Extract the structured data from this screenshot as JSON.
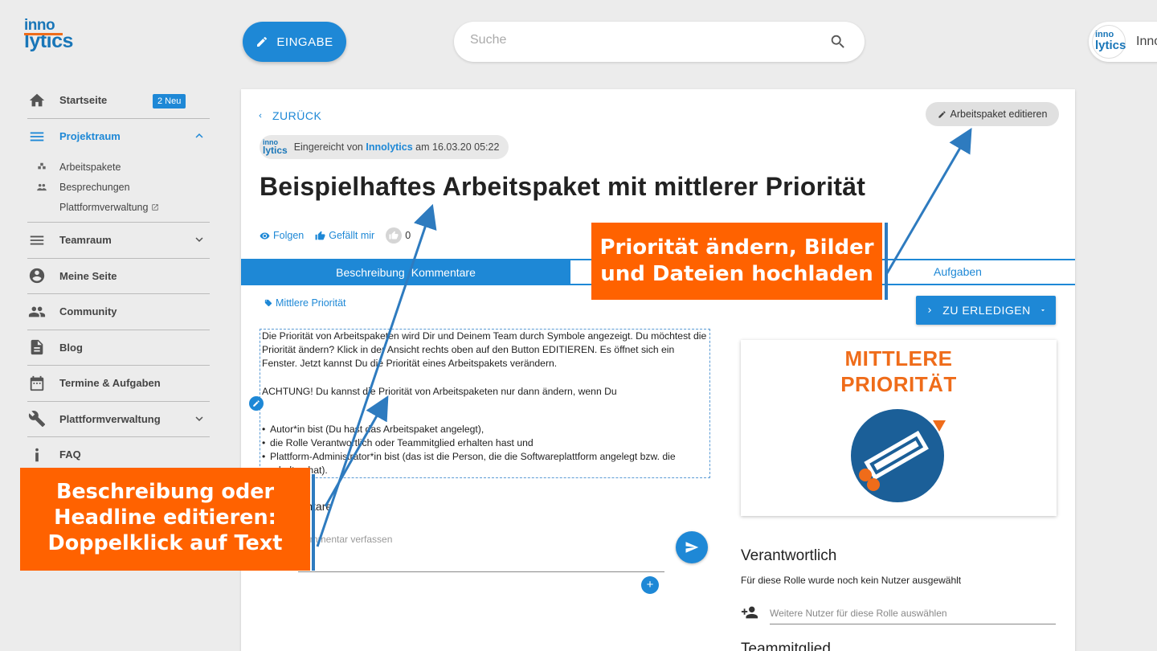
{
  "logo": {
    "line1": "inno",
    "line2": "lytics"
  },
  "topbar": {
    "entry_button": "EINGABE",
    "search_placeholder": "Suche",
    "user_avatar_line1": "inno",
    "user_avatar_line2": "lytics",
    "user_name": "Inno"
  },
  "sidebar": {
    "home": {
      "label": "Startseite",
      "badge": "2 Neu"
    },
    "project": {
      "label": "Projektraum"
    },
    "project_sub": [
      {
        "label": "Arbeitspakete"
      },
      {
        "label": "Besprechungen"
      },
      {
        "label": "Plattformverwaltung"
      }
    ],
    "team": {
      "label": "Teamraum"
    },
    "mypage": {
      "label": "Meine Seite"
    },
    "community": {
      "label": "Community"
    },
    "blog": {
      "label": "Blog"
    },
    "events": {
      "label": "Termine & Aufgaben"
    },
    "platform": {
      "label": "Plattformverwaltung"
    },
    "faq": {
      "label": "FAQ"
    }
  },
  "main": {
    "back_label": "ZURÜCK",
    "edit_button": "Arbeitspaket editieren",
    "submitted": {
      "prefix": "Eingereicht von",
      "org": "Innolytics",
      "suffix": "am 16.03.20 05:22",
      "logo1": "inno",
      "logo2": "lytics"
    },
    "title": "Beispielhaftes Arbeitspaket mit mittlerer Priorität",
    "actions": {
      "follow": "Folgen",
      "like": "Gefällt mir",
      "count": "0"
    },
    "tabs": {
      "description": "Beschreibung",
      "comments": "Kommentare",
      "tasks": "Aufgaben"
    },
    "priority_tag": "Mittlere Priorität",
    "todo_button": "ZU ERLEDIGEN",
    "description": {
      "para1": "Die Priorität von Arbeitspaketen wird Dir und Deinem Team durch Symbole angezeigt. Du möchtest die Priorität ändern? Klick in der Ansicht rechts oben auf den Button EDITIEREN. Es öffnet sich ein Fenster. Jetzt kannst Du die Priorität eines Arbeitspakets verändern.",
      "para2": "ACHTUNG! Du kannst die Priorität von Arbeitspaketen nur dann ändern, wenn Du",
      "items": [
        "Autor*in bist (Du hast das Arbeitspaket angelegt),",
        "die Rolle Verantwortlich oder Teammitglied erhalten hast und",
        "Plattform-Administrator*in bist (das ist die Person, die die Softwareplattform angelegt bzw. die erhalten hat)."
      ]
    },
    "comments_label": "Kommentare",
    "comment_placeholder": "Kommentar verfassen",
    "priority_image": {
      "line1": "MITTLERE",
      "line2": "PRIORITÄT"
    },
    "responsible": {
      "title": "Verantwortlich",
      "note": "Für diese Rolle wurde noch kein Nutzer ausgewählt",
      "input_placeholder": "Weitere Nutzer für diese Rolle auswählen"
    },
    "team_member_title": "Teammitglied"
  },
  "annotations": {
    "right": {
      "line1": "Priorität ändern, Bilder",
      "line2": "und Dateien hochladen"
    },
    "left": {
      "line1": "Beschreibung oder",
      "line2": "Headline editieren:",
      "line3": "Doppelklick auf Text"
    }
  },
  "colors": {
    "accent": "#1e88d6",
    "callout": "#ff6200",
    "arrow": "#2e7bbf",
    "brand_orange": "#ef6c1a"
  }
}
